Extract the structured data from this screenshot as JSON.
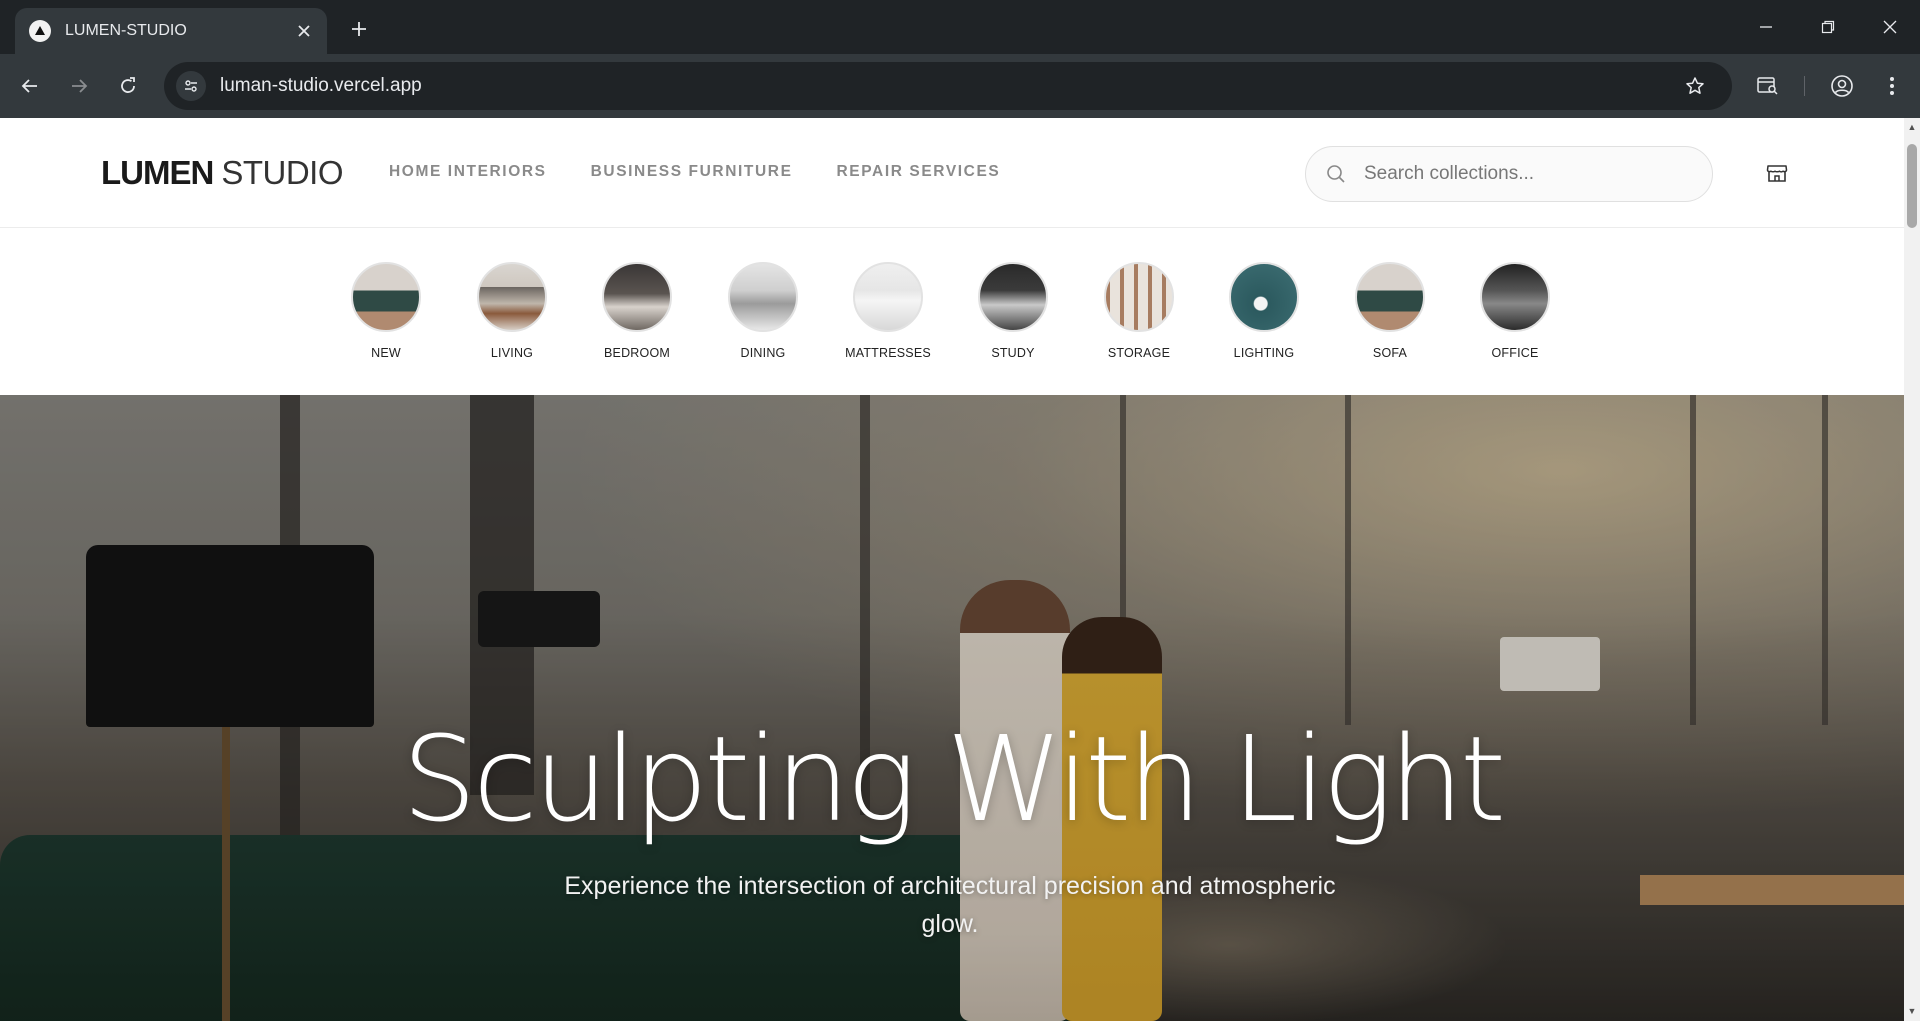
{
  "browser": {
    "tab_title": "LUMEN-STUDIO",
    "url": "luman-studio.vercel.app"
  },
  "site": {
    "logo_bold": "LUMEN",
    "logo_light": "STUDIO",
    "nav": [
      "HOME INTERIORS",
      "BUSINESS FURNITURE",
      "REPAIR SERVICES"
    ],
    "search_placeholder": "Search collections..."
  },
  "categories": [
    {
      "label": "NEW",
      "icon": "sofa-thumbnail"
    },
    {
      "label": "LIVING",
      "icon": "living-room-thumbnail"
    },
    {
      "label": "BEDROOM",
      "icon": "bedroom-thumbnail"
    },
    {
      "label": "DINING",
      "icon": "dining-thumbnail"
    },
    {
      "label": "MATTRESSES",
      "icon": "mattress-thumbnail"
    },
    {
      "label": "STUDY",
      "icon": "study-thumbnail"
    },
    {
      "label": "STORAGE",
      "icon": "storage-thumbnail"
    },
    {
      "label": "LIGHTING",
      "icon": "lamp-thumbnail"
    },
    {
      "label": "SOFA",
      "icon": "sofa-thumbnail"
    },
    {
      "label": "OFFICE",
      "icon": "office-thumbnail"
    }
  ],
  "hero": {
    "title": "Sculpting With Light",
    "subtitle": "Experience the intersection of architectural precision and atmospheric glow."
  },
  "colors": {
    "chrome_dark": "#1f2326",
    "chrome_toolbar": "#33393d",
    "nav_text": "#8a8a8a",
    "logo": "#1a1a1a"
  }
}
